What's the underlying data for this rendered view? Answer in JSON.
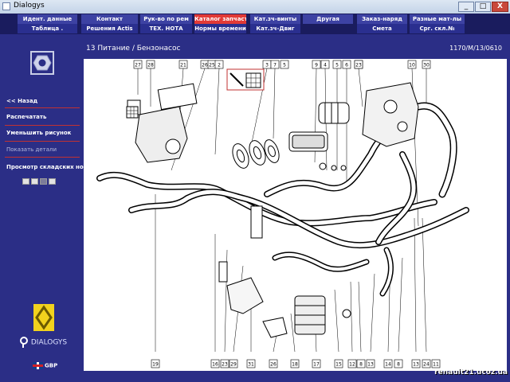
{
  "window": {
    "title": "Dialogys",
    "minimize": "_",
    "maximize": "□",
    "close": "X"
  },
  "tabs": {
    "row1": [
      "Идент. данные",
      "Контакт",
      "Рук-во по рем",
      "Каталог запчастей",
      "Кат.зч-винты",
      "Другая",
      "Заказ-наряд",
      "Разные мат-лы"
    ],
    "row2": [
      "Таблица .",
      "Решения Actis",
      "ТЕХ. НОТА",
      "Нормы времени",
      "Кат.зч-Двиг",
      "",
      "Смета",
      "Срг. скл.№"
    ],
    "selected": "Каталог запчастей"
  },
  "sidebar": {
    "back": "<< Назад",
    "print": "Распечатать",
    "zoom_out": "Уменьшить рисунок",
    "show_details": "Показать детали",
    "stock_view": "Просмотр складских но...",
    "pager": [
      "",
      "",
      "",
      ""
    ]
  },
  "brand": {
    "product": "DIALOGYS",
    "language": "GBP"
  },
  "header": {
    "title": "13 Питание / Бензонасос",
    "reference": "1170/M/13/0610"
  },
  "diagram": {
    "top_callouts": [
      "27",
      "28",
      "21",
      "26",
      "25",
      "2",
      "3",
      "7",
      "5",
      "9",
      "4",
      "5",
      "6",
      "7",
      "23",
      "10",
      "30"
    ],
    "bottom_callouts": [
      "19",
      "16",
      "23",
      "29",
      "31",
      "26",
      "18",
      "17",
      "15",
      "12",
      "8",
      "13",
      "14",
      "8",
      "13",
      "24",
      "11"
    ]
  },
  "watermark": "renault21.ucoz.ua",
  "colors": {
    "tab_selected": "#e23a36",
    "background": "#2b2e86",
    "tab_bar": "#1a1c5e"
  }
}
